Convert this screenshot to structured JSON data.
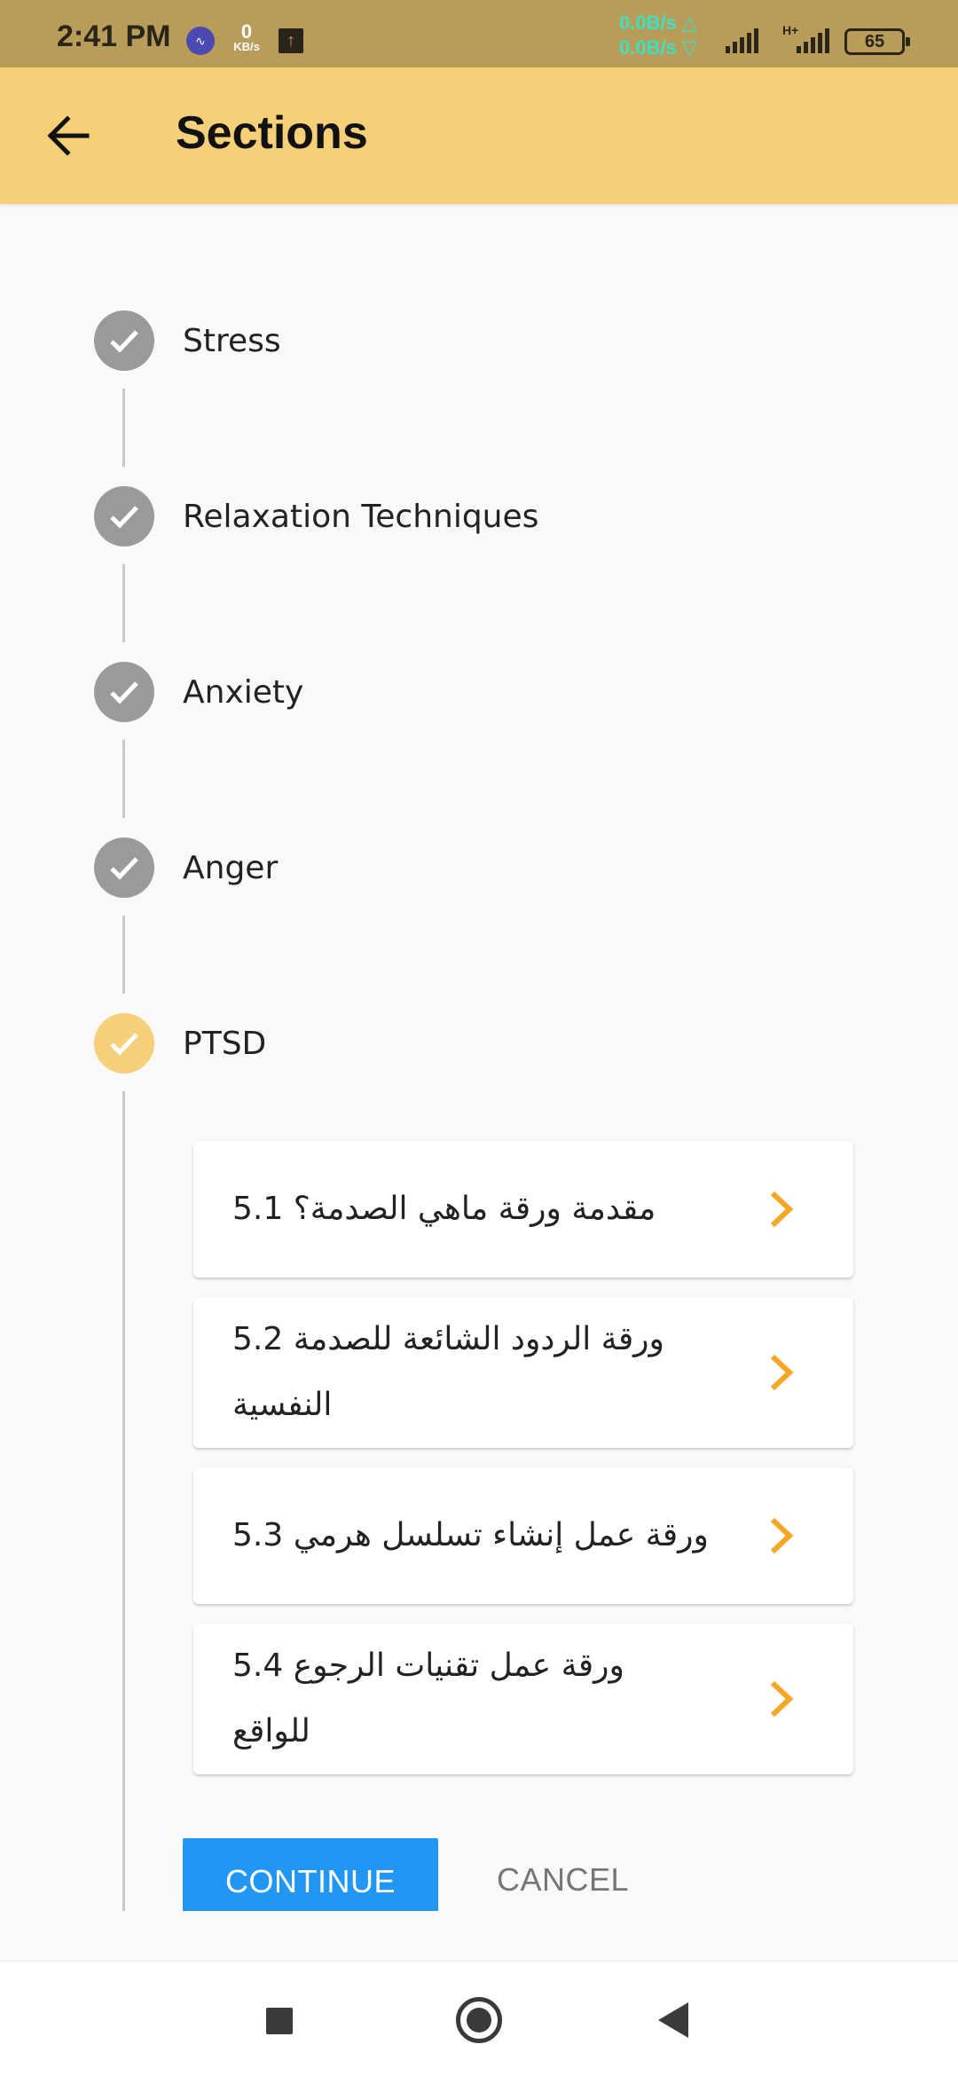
{
  "status_bar": {
    "time": "2:41 PM",
    "speed_value": "0",
    "speed_unit": "KB/s",
    "upload_rate": "0.0B/s △",
    "download_rate": "0.0B/s ▽",
    "network_type": "H+",
    "battery": "65"
  },
  "app_bar": {
    "title": "Sections",
    "back_icon": "arrow-left-icon"
  },
  "steps": [
    {
      "label": "Stress",
      "completed": true
    },
    {
      "label": "Relaxation Techniques",
      "completed": true
    },
    {
      "label": "Anxiety",
      "completed": true
    },
    {
      "label": "Anger",
      "completed": true
    },
    {
      "label": "PTSD",
      "completed": false,
      "active": true
    }
  ],
  "cards": [
    {
      "line1": "5.1 مقدمة ورقة ماهي الصدمة؟",
      "line2": ""
    },
    {
      "line1": "5.2  ورقة الردود الشائعة للصدمة",
      "line2": "النفسية"
    },
    {
      "line1": "5.3 ورقة عمل إنشاء تسلسل هرمي",
      "line2": ""
    },
    {
      "line1": "5.4  ورقة عمل تقنيات الرجوع",
      "line2": "للواقع"
    }
  ],
  "actions": {
    "continue_label": "CONTINUE",
    "cancel_label": "CANCEL"
  },
  "colors": {
    "status_bar": "#b89d5a",
    "app_bar": "#f6cf79",
    "accent_orange": "#f5a623",
    "completed_step": "#9a9a9a",
    "continue_button": "#2196f3"
  }
}
